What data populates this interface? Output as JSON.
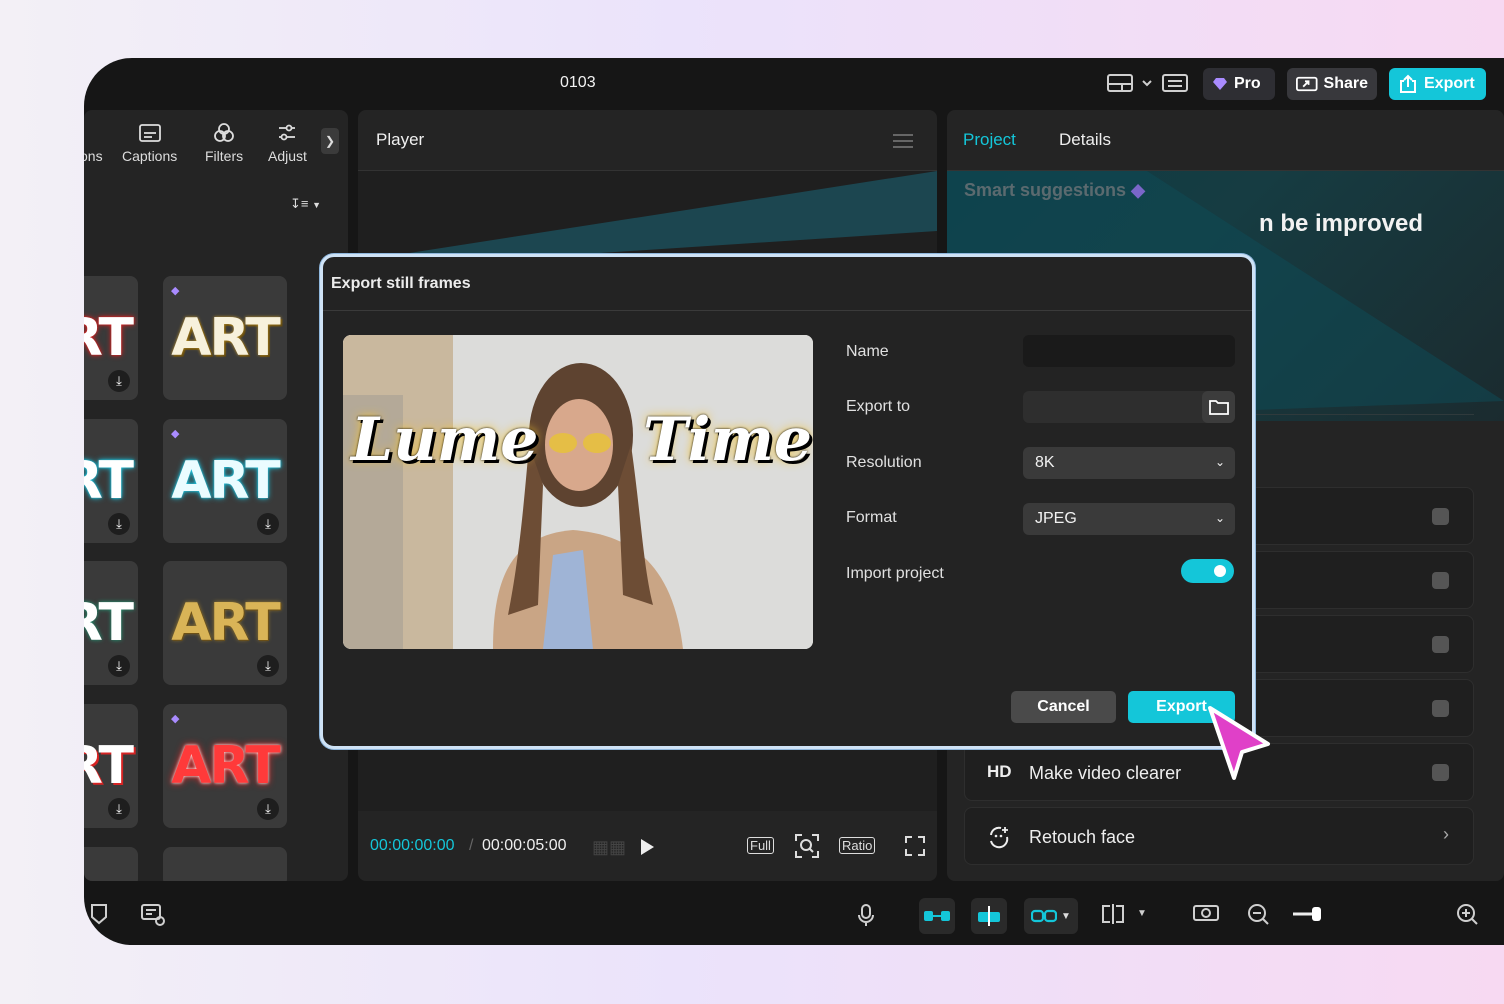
{
  "app": {
    "project_title": "0103",
    "pro_label": "Pro",
    "share_label": "Share",
    "export_label": "Export"
  },
  "left_panel": {
    "tabs": [
      {
        "label": "ons",
        "icon": "captions-partial-icon"
      },
      {
        "label": "Captions",
        "icon": "captions-icon"
      },
      {
        "label": "Filters",
        "icon": "filters-icon"
      },
      {
        "label": "Adjust",
        "icon": "adjust-icon"
      }
    ],
    "tiles": [
      {
        "text": "RT",
        "style": "red-glow"
      },
      {
        "text": "ART",
        "style": "gold-sparkle",
        "premium": true
      },
      {
        "text": "RT",
        "style": "cyan-glow"
      },
      {
        "text": "ART",
        "style": "cyan-glow",
        "premium": true
      },
      {
        "text": "RT",
        "style": "white"
      },
      {
        "text": "ART",
        "style": "gold-glitter"
      },
      {
        "text": "RT",
        "style": "red-white"
      },
      {
        "text": "ART",
        "style": "red-neon",
        "premium": true
      }
    ]
  },
  "player": {
    "title": "Player",
    "current_time": "00:00:00:00",
    "separator": "/",
    "total_time": "00:00:05:00",
    "full_label": "Full",
    "ratio_label": "Ratio"
  },
  "right_panel": {
    "tabs": [
      "Project",
      "Details"
    ],
    "smart_suggestions": "Smart suggestions",
    "headline": "n be improved",
    "cards": [
      {
        "icon_text": "",
        "label": ""
      },
      {
        "icon_text": "",
        "label": ""
      },
      {
        "icon_text": "",
        "label": ""
      },
      {
        "icon_text": "",
        "label": ""
      },
      {
        "icon_text": "HD",
        "label": "Make video clearer"
      },
      {
        "icon_text": "",
        "label": "Retouch face"
      }
    ]
  },
  "modal": {
    "title": "Export still frames",
    "preview_caption_left": "Lume",
    "preview_caption_right": "Time",
    "name_label": "Name",
    "name_value": "",
    "export_to_label": "Export to",
    "export_to_value": "",
    "resolution_label": "Resolution",
    "resolution_value": "8K",
    "format_label": "Format",
    "format_value": "JPEG",
    "import_label": "Import project",
    "import_enabled": true,
    "cancel_label": "Cancel",
    "export_label": "Export"
  },
  "colors": {
    "accent": "#14c6d9",
    "cursor": "#e040c8",
    "premium": "#a98bff"
  }
}
